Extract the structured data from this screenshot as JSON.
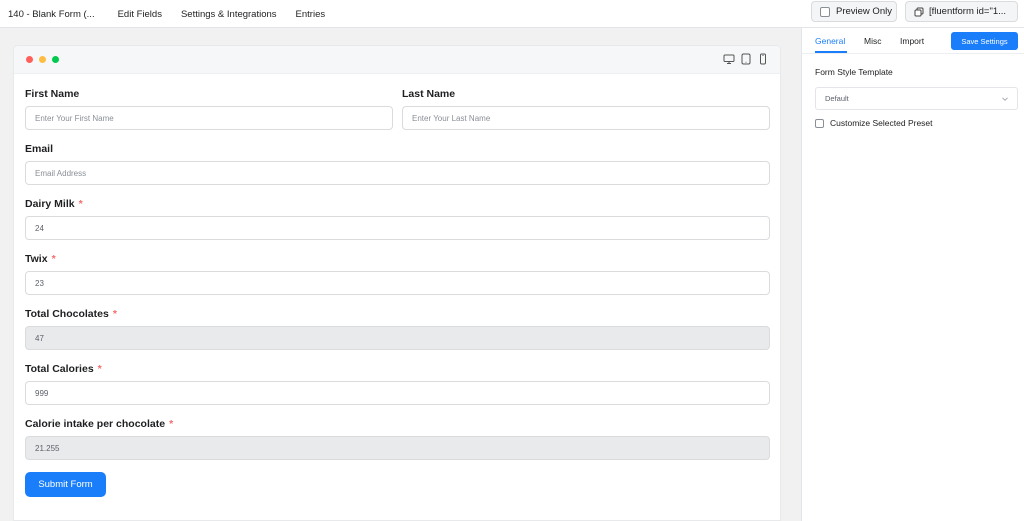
{
  "topnav": {
    "title": "140 - Blank Form (...",
    "edit_fields": "Edit Fields",
    "settings": "Settings & Integrations",
    "entries": "Entries"
  },
  "toolbar": {
    "preview_only": "Preview Only",
    "shortcode": "[fluentform id=\"1..."
  },
  "form": {
    "first_name": {
      "label": "First Name",
      "placeholder": "Enter Your First Name"
    },
    "last_name": {
      "label": "Last Name",
      "placeholder": "Enter Your Last Name"
    },
    "email": {
      "label": "Email",
      "placeholder": "Email Address"
    },
    "dairy_milk": {
      "label": "Dairy Milk",
      "value": "24",
      "required": "*"
    },
    "twix": {
      "label": "Twix",
      "value": "23",
      "required": "*"
    },
    "total_chocolates": {
      "label": "Total Chocolates",
      "value": "47",
      "required": "*"
    },
    "total_calories": {
      "label": "Total Calories",
      "value": "999",
      "required": "*"
    },
    "calorie_intake": {
      "label": "Calorie intake per chocolate",
      "value": "21.255",
      "required": "*"
    },
    "submit_label": "Submit Form"
  },
  "panel": {
    "tabs": [
      "General",
      "Misc",
      "Import"
    ],
    "active_tab": "General",
    "save_label": "Save Settings",
    "style_template_label": "Form Style Template",
    "style_template_value": "Default",
    "customize_label": "Customize Selected Preset"
  },
  "colors": {
    "accent": "#1a7efb",
    "required": "#f56c6c",
    "dot_red": "#ff605c",
    "dot_yellow": "#ffbd44",
    "dot_green": "#00ca4e"
  },
  "icons": {
    "copy": "copy-icon",
    "desktop": "desktop-icon",
    "tablet": "tablet-icon",
    "mobile": "mobile-icon",
    "chevron": "chevron-down-icon"
  }
}
